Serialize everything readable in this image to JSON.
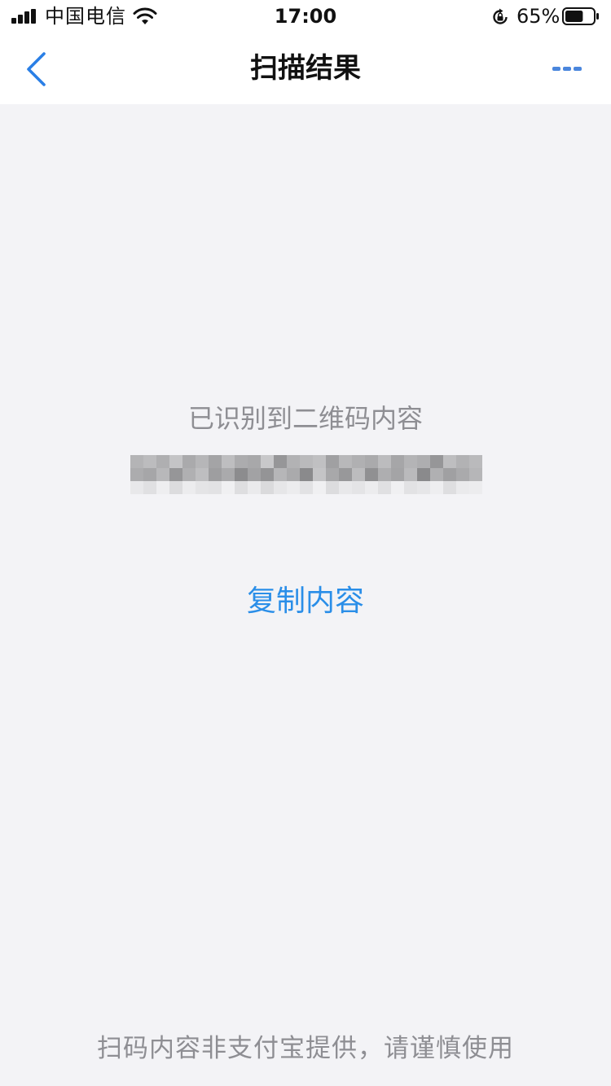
{
  "status_bar": {
    "carrier": "中国电信",
    "time": "17:00",
    "battery_percent": "65%",
    "battery_level": 0.65,
    "icons": [
      "signal-icon",
      "wifi-icon",
      "rotation-lock-icon",
      "battery-icon"
    ]
  },
  "nav": {
    "back_icon": "chevron-left-icon",
    "title": "扫描结果",
    "more_icon": "more-icon"
  },
  "content": {
    "result_label": "已识别到二维码内容",
    "copy_label": "复制内容"
  },
  "footer": {
    "disclaimer": "扫码内容非支付宝提供，请谨慎使用"
  },
  "colors": {
    "background": "#f3f3f6",
    "accent": "#2a8ee8",
    "secondary_text": "#8e8e93",
    "title_text": "#111111"
  }
}
